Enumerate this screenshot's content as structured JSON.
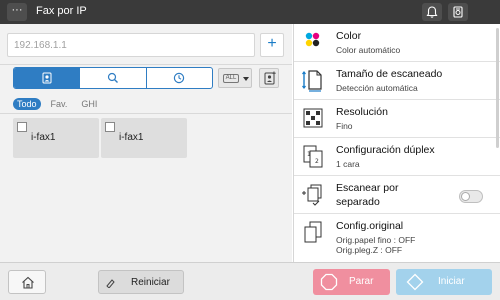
{
  "header": {
    "menu_label": "···",
    "title": "Fax por IP",
    "icons": [
      "bell-icon",
      "device-status-icon"
    ]
  },
  "address": {
    "value": "192.168.1.1",
    "add_label": "+"
  },
  "view_tabs": [
    "address-book-icon",
    "search-icon",
    "history-icon"
  ],
  "filter": {
    "selected": "ALL"
  },
  "index_tabs": [
    "Todo",
    "Fav.",
    "GHI"
  ],
  "destinations": [
    {
      "label": "i-fax1"
    },
    {
      "label": "i-fax1"
    }
  ],
  "settings": [
    {
      "title": "Color",
      "value": "Color automático",
      "icon": "color-icon"
    },
    {
      "title": "Tamaño de escaneado",
      "value": "Detección automática",
      "icon": "scan-size-icon"
    },
    {
      "title": "Resolución",
      "value": "Fino",
      "icon": "resolution-icon"
    },
    {
      "title": "Configuración dúplex",
      "value": "1 cara",
      "icon": "duplex-icon"
    },
    {
      "title": "Escanear por",
      "title2": "separado",
      "icon": "separate-scan-icon",
      "toggle": "off"
    },
    {
      "title": "Config.original",
      "value": "Orig.papel fino : OFF",
      "value2": "Orig.pleg.Z : OFF",
      "icon": "original-settings-icon"
    }
  ],
  "footer": {
    "reset_label": "Reiniciar",
    "stop_label": "Parar",
    "start_label": "Iniciar"
  },
  "colors": {
    "header_bg": "#3a3a3a",
    "accent": "#2f7dc3",
    "stop": "#f08f9f",
    "start": "#a3d2ec"
  }
}
